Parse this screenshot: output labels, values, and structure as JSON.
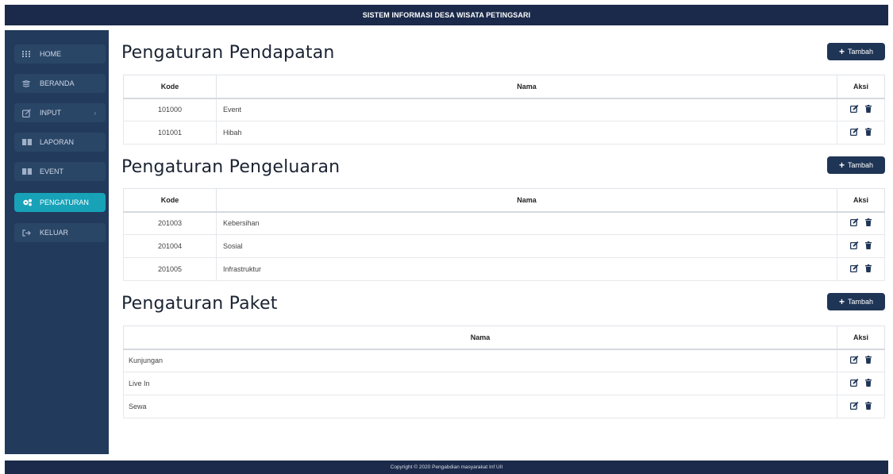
{
  "header": {
    "title": "SISTEM INFORMASI DESA WISATA PETINGSARI"
  },
  "sidebar": {
    "items": [
      {
        "label": "HOME",
        "icon": "grid-icon"
      },
      {
        "label": "BERANDA",
        "icon": "layers-icon"
      },
      {
        "label": "INPUT",
        "icon": "edit-icon",
        "has_caret": true
      },
      {
        "label": "LAPORAN",
        "icon": "book-icon"
      },
      {
        "label": "EVENT",
        "icon": "book-icon"
      },
      {
        "label": "PENGATURAN",
        "icon": "cogs-icon",
        "active": true
      },
      {
        "label": "KELUAR",
        "icon": "sign-out-icon"
      }
    ]
  },
  "sections": {
    "pendapatan": {
      "title": "Pengaturan Pendapatan",
      "add_label": "Tambah",
      "headers": {
        "kode": "Kode",
        "nama": "Nama",
        "aksi": "Aksi"
      },
      "rows": [
        {
          "kode": "101000",
          "nama": "Event"
        },
        {
          "kode": "101001",
          "nama": "Hibah"
        }
      ]
    },
    "pengeluaran": {
      "title": "Pengaturan Pengeluaran",
      "add_label": "Tambah",
      "headers": {
        "kode": "Kode",
        "nama": "Nama",
        "aksi": "Aksi"
      },
      "rows": [
        {
          "kode": "201003",
          "nama": "Kebersihan"
        },
        {
          "kode": "201004",
          "nama": "Sosial"
        },
        {
          "kode": "201005",
          "nama": "Infrastruktur"
        }
      ]
    },
    "paket": {
      "title": "Pengaturan Paket",
      "add_label": "Tambah",
      "headers": {
        "nama": "Nama",
        "aksi": "Aksi"
      },
      "rows": [
        {
          "nama": "Kunjungan"
        },
        {
          "nama": "Live In"
        },
        {
          "nama": "Sewa"
        }
      ]
    }
  },
  "footer": {
    "text": "Copyright © 2020 Pengabdian masyarakat Inf UII"
  },
  "colors": {
    "navy": "#1b2a4a",
    "sidebar": "#223a5c",
    "active": "#17a2b8"
  }
}
